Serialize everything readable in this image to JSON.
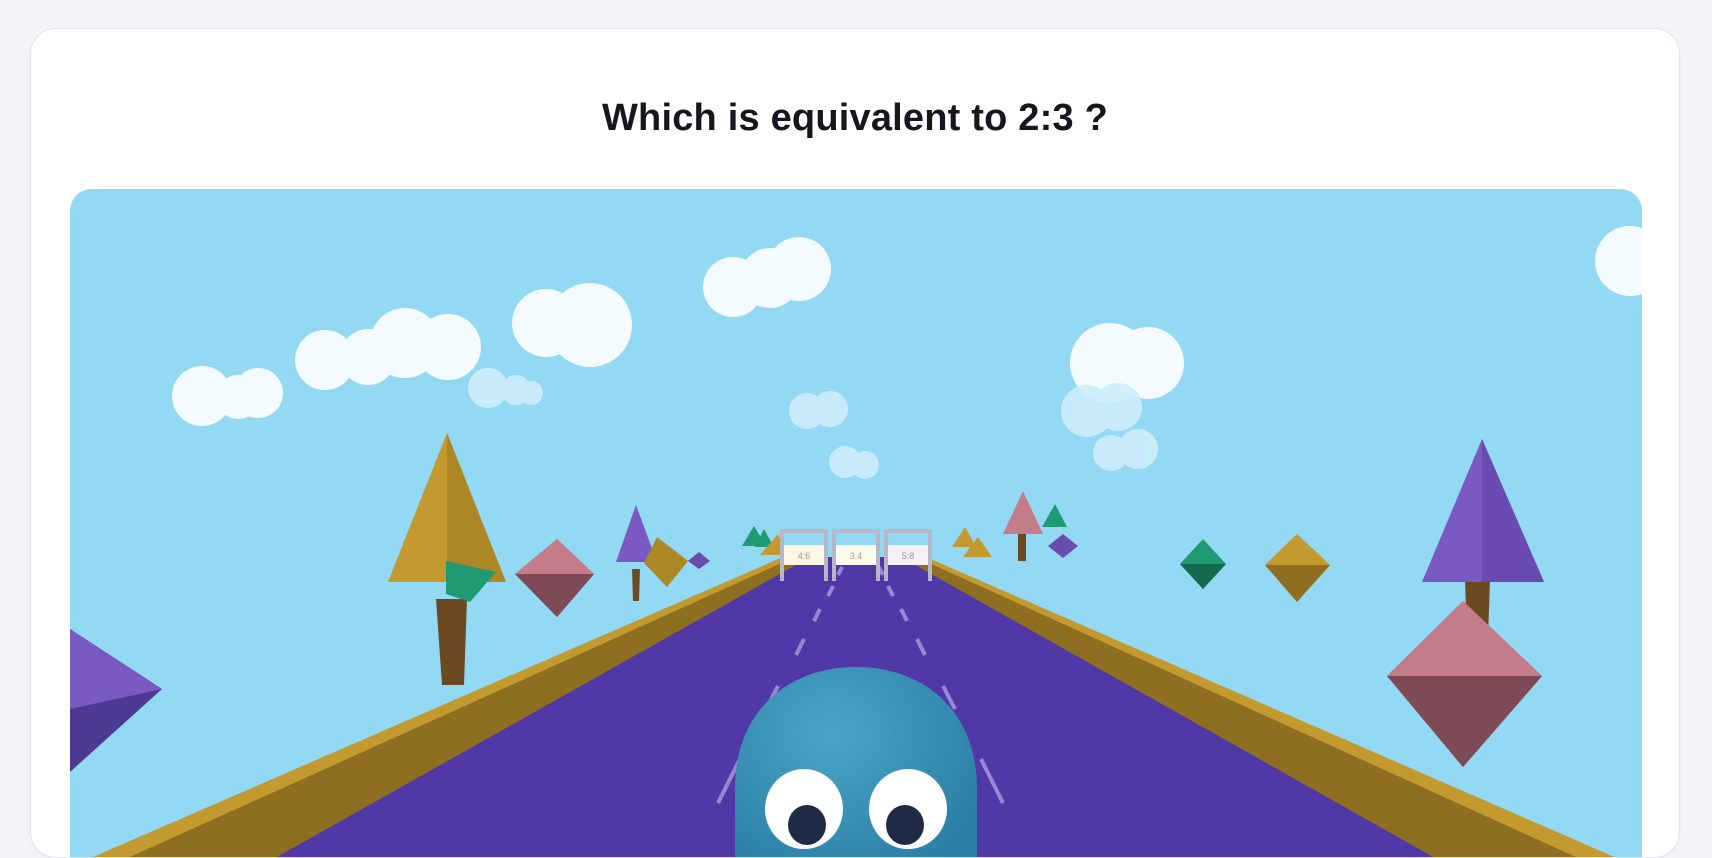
{
  "question": {
    "text": "Which is equivalent to 2:3 ?"
  },
  "game": {
    "gates": [
      {
        "label": "4:6"
      },
      {
        "label": "3:4"
      },
      {
        "label": "5:8"
      }
    ],
    "colors": {
      "sky": "#93d9f3",
      "road": "#5038a6",
      "rail": "#c39a2f",
      "player": "#3b93bb",
      "tree_gold": "#c39a2f",
      "tree_purple": "#7a5ac2",
      "gem_pink": "#b7707e",
      "gem_green": "#1f9a73"
    }
  }
}
